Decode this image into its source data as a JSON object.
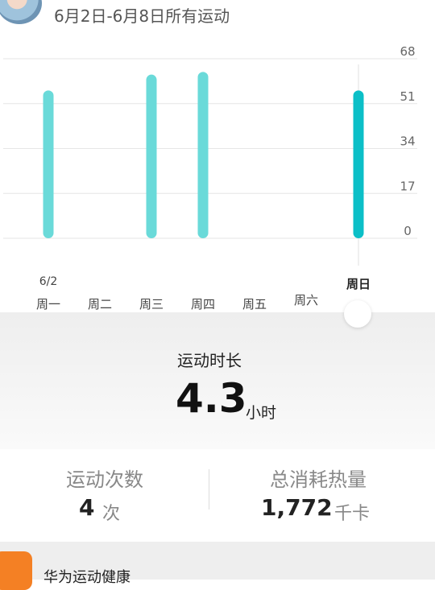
{
  "header": {
    "date_range": "6月2日-6月8日所有运动"
  },
  "chart_data": {
    "type": "bar",
    "categories": [
      "周一",
      "周二",
      "周三",
      "周四",
      "周五",
      "周六",
      "周日"
    ],
    "values": [
      56,
      0,
      62,
      63,
      0,
      0,
      56
    ],
    "ylim": [
      0,
      68
    ],
    "yticks": [
      "68",
      "51",
      "34",
      "17",
      "0"
    ],
    "grid": true,
    "date_label": "6/2",
    "selected": "周日",
    "bar_color": "#6adad9",
    "selected_color": "#0bbfc7"
  },
  "summary": {
    "duration_title": "运动时长",
    "duration_value": "4.3",
    "duration_unit": "小时"
  },
  "stats": {
    "count_label": "运动次数",
    "count_value": "4",
    "count_unit": "次",
    "calories_label": "总消耗热量",
    "calories_value": "1,772",
    "calories_unit": "千卡"
  },
  "footer": {
    "app_name": "华为运动健康"
  }
}
